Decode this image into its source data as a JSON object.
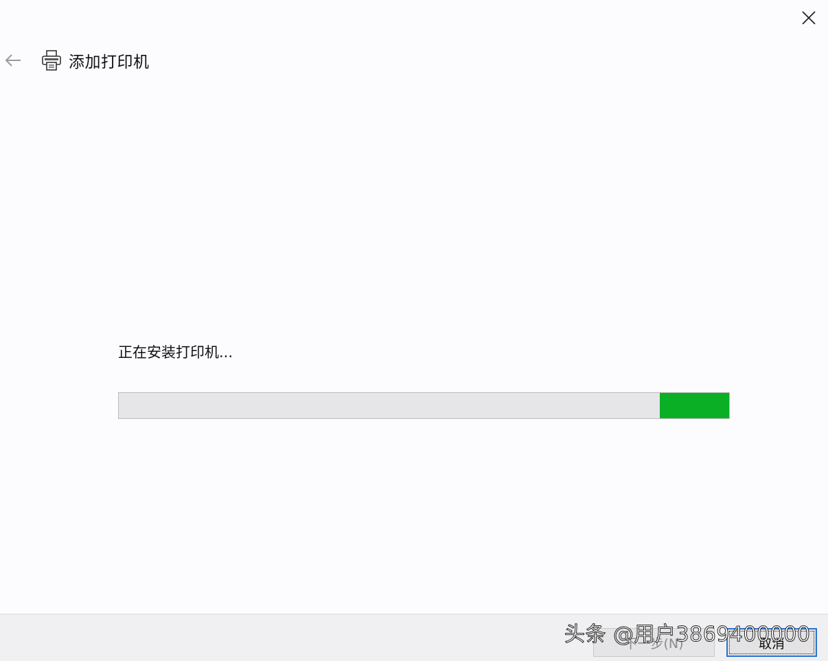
{
  "window": {
    "title": "添加打印机"
  },
  "status": {
    "text": "正在安装打印机..."
  },
  "progress": {
    "mode": "indeterminate",
    "segment_start": 0.886,
    "segment_end": 1.0,
    "fill_color": "#0aaf26"
  },
  "footer": {
    "next_label": "下一步(N)",
    "cancel_label": "取消"
  },
  "watermark": {
    "text": "头条 @用户3869400000"
  },
  "icons": {
    "close": "close-icon",
    "back": "back-arrow-icon",
    "printer": "printer-icon"
  }
}
